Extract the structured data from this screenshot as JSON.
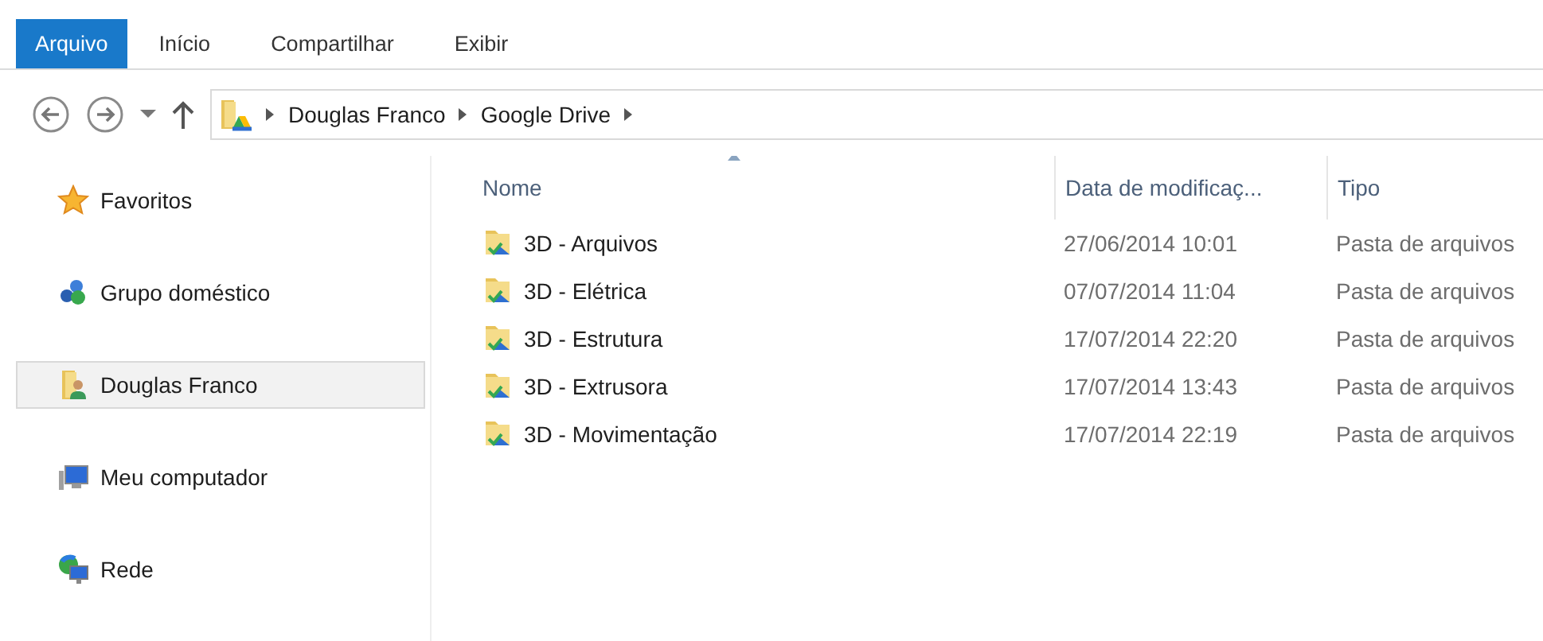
{
  "ribbon_tabs": [
    {
      "label": "Arquivo",
      "selected": true
    },
    {
      "label": "Início",
      "selected": false
    },
    {
      "label": "Compartilhar",
      "selected": false
    },
    {
      "label": "Exibir",
      "selected": false
    }
  ],
  "breadcrumb": [
    "Douglas Franco",
    "Google Drive"
  ],
  "sidebar": {
    "items": [
      {
        "label": "Favoritos",
        "kind": "favorites",
        "selected": false
      },
      {
        "label": "Grupo doméstico",
        "kind": "homegroup",
        "selected": false
      },
      {
        "label": "Douglas Franco",
        "kind": "user",
        "selected": true
      },
      {
        "label": "Meu computador",
        "kind": "computer",
        "selected": false
      },
      {
        "label": "Rede",
        "kind": "network",
        "selected": false
      }
    ]
  },
  "table": {
    "columns": [
      "Nome",
      "Data de modificaç...",
      "Tipo"
    ],
    "rows": [
      [
        "3D - Arquivos",
        "27/06/2014 10:01",
        "Pasta de arquivos"
      ],
      [
        "3D - Elétrica",
        "07/07/2014 11:04",
        "Pasta de arquivos"
      ],
      [
        "3D - Estrutura",
        "17/07/2014 22:20",
        "Pasta de arquivos"
      ],
      [
        "3D - Extrusora",
        "17/07/2014 13:43",
        "Pasta de arquivos"
      ],
      [
        "3D - Movimentação",
        "17/07/2014 22:19",
        "Pasta de arquivos"
      ]
    ]
  }
}
